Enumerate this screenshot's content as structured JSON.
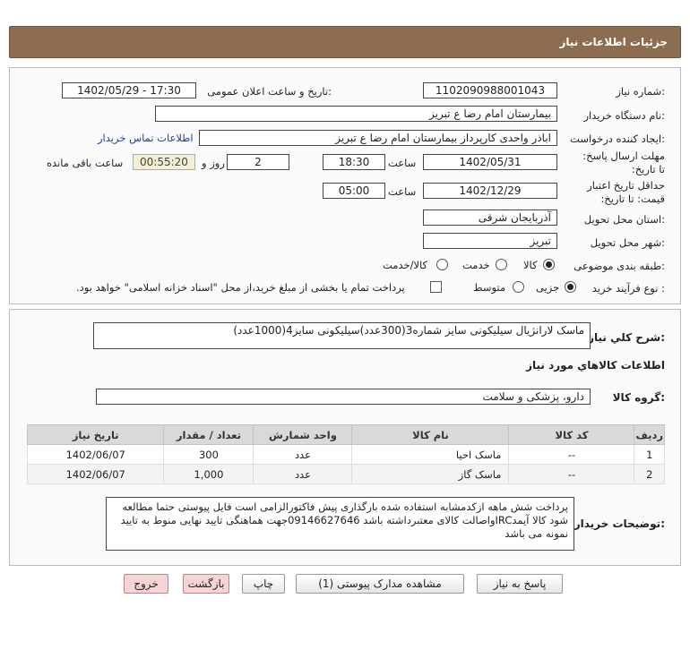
{
  "header": {
    "title": "جزئیات اطلاعات نیاز"
  },
  "fields": {
    "need_number_label": "شماره نیاز:",
    "need_number": "1102090988001043",
    "announce_label": "تاریخ و ساعت اعلان عمومی:",
    "announce_value": "1402/05/29 - 17:30",
    "buyer_org_label": "نام دستگاه خریدار:",
    "buyer_org": "بیمارستان امام رضا  ع  تبریز",
    "requester_label": "ایجاد کننده درخواست:",
    "requester": "اباذر واحدی کارپرداز بیمارستان امام رضا  ع  تبریز",
    "contact_link": "اطلاعات تماس خریدار",
    "deadline_label": "مهلت ارسال پاسخ: تا تاریخ:",
    "deadline_date": "1402/05/31",
    "time_label": "ساعت",
    "deadline_time": "18:30",
    "days": "2",
    "days_label": "روز و",
    "remaining_time": "00:55:20",
    "remaining_label": "ساعت باقی مانده",
    "validity_label": "حداقل تاریخ اعتبار قیمت: تا تاریخ:",
    "validity_date": "1402/12/29",
    "validity_time": "05:00",
    "province_label": "استان محل تحویل:",
    "province": "آذربایجان شرقی",
    "city_label": "شهر محل تحویل:",
    "city": "تبریز",
    "category_label": "طبقه بندی موضوعی:",
    "cat_goods": "کالا",
    "cat_service": "خدمت",
    "cat_goods_service": "کالا/خدمت",
    "process_label": "نوع فرآیند خرید :",
    "proc_partial": "جزیی",
    "proc_medium": "متوسط",
    "payment_note": "پرداخت تمام یا بخشی از مبلغ خرید،از محل \"اسناد خزانه اسلامی\" خواهد بود."
  },
  "section2": {
    "summary_label": "شرح کلي نياز:",
    "summary": "ماسک لارانژیال سیلیکونی سایز شماره3(300عدد)سیلیکونی سایز4(1000عدد)",
    "items_title": "اطلاعات کالاهاي مورد نياز",
    "group_label": "گروه کالا:",
    "group": "دارو، پزشکی و سلامت",
    "columns": [
      "ردیف",
      "کد کالا",
      "نام کالا",
      "واحد شمارش",
      "تعداد / مقدار",
      "تاریخ نیاز"
    ],
    "rows": [
      [
        "1",
        "--",
        "ماسک احیا",
        "عدد",
        "300",
        "1402/06/07"
      ],
      [
        "2",
        "--",
        "ماسک گاز",
        "عدد",
        "1,000",
        "1402/06/07"
      ]
    ],
    "buyer_notes_label": "توضیحات خریدار:",
    "buyer_notes": "پرداخت شش ماهه ازکدمشابه استفاده شده بارگذاری پیش فاکتورالزامی است فایل پیوستی حتما مطالعه شود کالا آیمدIRCواصالت کالای معتبرداشته باشد 09146627646جهت هماهنگی تایید نهایی منوط به تایید نمونه می باشد"
  },
  "buttons": {
    "reply": "پاسخ به نیاز",
    "attachments": "مشاهده مدارک پیوستی (1)",
    "print": "چاپ",
    "back": "بازگشت",
    "exit": "خروج"
  },
  "colors": {
    "header_bg": "#8c6d4f",
    "link": "#1a3fb0",
    "back_btn": "#f4d4d4"
  }
}
